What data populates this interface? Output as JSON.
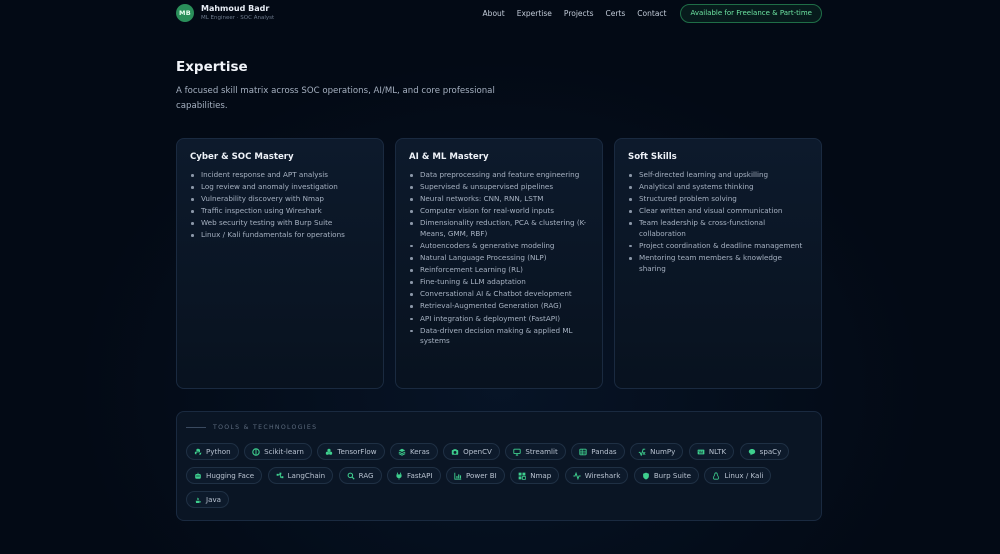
{
  "header": {
    "avatar_initials": "MB",
    "name": "Mahmoud Badr",
    "role": "ML Engineer · SOC Analyst",
    "nav": [
      "About",
      "Expertise",
      "Projects",
      "Certs",
      "Contact"
    ],
    "cta": "Available for Freelance & Part-time"
  },
  "section": {
    "title": "Expertise",
    "subtitle": "A focused skill matrix across SOC operations, AI/ML, and core professional capabilities."
  },
  "cards": [
    {
      "title": "Cyber & SOC Mastery",
      "items": [
        "Incident response and APT analysis",
        "Log review and anomaly investigation",
        "Vulnerability discovery with Nmap",
        "Traffic inspection using Wireshark",
        "Web security testing with Burp Suite",
        "Linux / Kali fundamentals for operations"
      ]
    },
    {
      "title": "AI & ML Mastery",
      "items": [
        "Data preprocessing and feature engineering",
        "Supervised & unsupervised pipelines",
        "Neural networks: CNN, RNN, LSTM",
        "Computer vision for real-world inputs",
        "Dimensionality reduction, PCA & clustering (K-Means, GMM, RBF)",
        "Autoencoders & generative modeling",
        "Natural Language Processing (NLP)",
        "Reinforcement Learning (RL)",
        "Fine-tuning & LLM adaptation",
        "Conversational AI & Chatbot development",
        "Retrieval-Augmented Generation (RAG)",
        "API integration & deployment (FastAPI)",
        "Data-driven decision making & applied ML systems"
      ]
    },
    {
      "title": "Soft Skills",
      "items": [
        "Self-directed learning and upskilling",
        "Analytical and systems thinking",
        "Structured problem solving",
        "Clear written and visual communication",
        "Team leadership & cross-functional collaboration",
        "Project coordination & deadline management",
        "Mentoring team members & knowledge sharing"
      ]
    }
  ],
  "tools": {
    "label": "TOOLS & TECHNOLOGIES",
    "accent": "#3ecf8e",
    "chips": [
      {
        "label": "Python",
        "icon": "python-icon"
      },
      {
        "label": "Scikit-learn",
        "icon": "scikit-learn-icon"
      },
      {
        "label": "TensorFlow",
        "icon": "tensorflow-icon"
      },
      {
        "label": "Keras",
        "icon": "keras-icon"
      },
      {
        "label": "OpenCV",
        "icon": "opencv-icon"
      },
      {
        "label": "Streamlit",
        "icon": "streamlit-icon"
      },
      {
        "label": "Pandas",
        "icon": "pandas-icon"
      },
      {
        "label": "NumPy",
        "icon": "numpy-icon"
      },
      {
        "label": "NLTK",
        "icon": "nltk-icon"
      },
      {
        "label": "spaCy",
        "icon": "spacy-icon"
      },
      {
        "label": "Hugging Face",
        "icon": "hugging-face-icon"
      },
      {
        "label": "LangChain",
        "icon": "langchain-icon"
      },
      {
        "label": "RAG",
        "icon": "rag-icon"
      },
      {
        "label": "FastAPI",
        "icon": "fastapi-icon"
      },
      {
        "label": "Power BI",
        "icon": "power-bi-icon"
      },
      {
        "label": "Nmap",
        "icon": "nmap-icon"
      },
      {
        "label": "Wireshark",
        "icon": "wireshark-icon"
      },
      {
        "label": "Burp Suite",
        "icon": "burp-suite-icon"
      },
      {
        "label": "Linux / Kali",
        "icon": "linux-icon"
      },
      {
        "label": "Java",
        "icon": "java-icon"
      }
    ]
  }
}
